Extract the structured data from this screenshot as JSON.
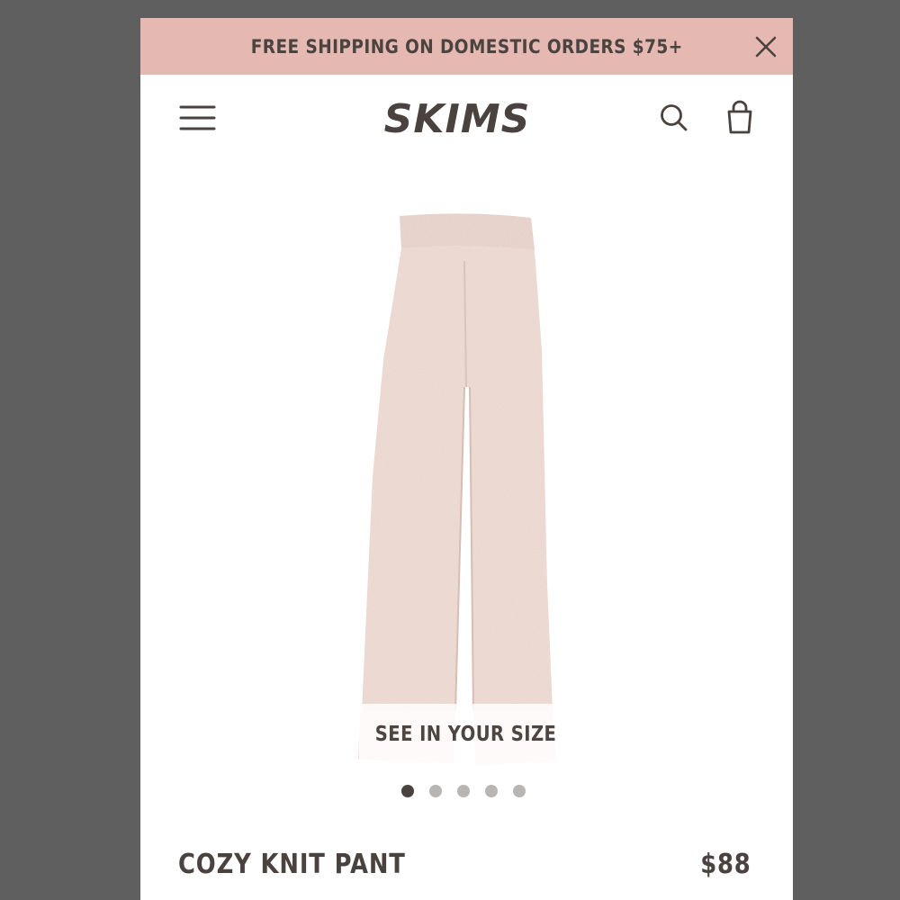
{
  "banner": {
    "text": "FREE SHIPPING ON DOMESTIC ORDERS $75+",
    "close_icon": "close-icon",
    "background": "#e6b8b2"
  },
  "header": {
    "brand": "SKIMS",
    "menu_icon": "hamburger-menu-icon",
    "search_icon": "search-icon",
    "bag_icon": "shopping-bag-icon",
    "text_color": "#4a423e"
  },
  "product": {
    "image_alt": "Cozy Knit Pant",
    "size_cta": "SEE IN YOUR SIZE",
    "title": "COZY KNIT PANT",
    "price": "$88",
    "color": "#e8d3cb"
  },
  "carousel": {
    "total": 5,
    "active_index": 0
  }
}
